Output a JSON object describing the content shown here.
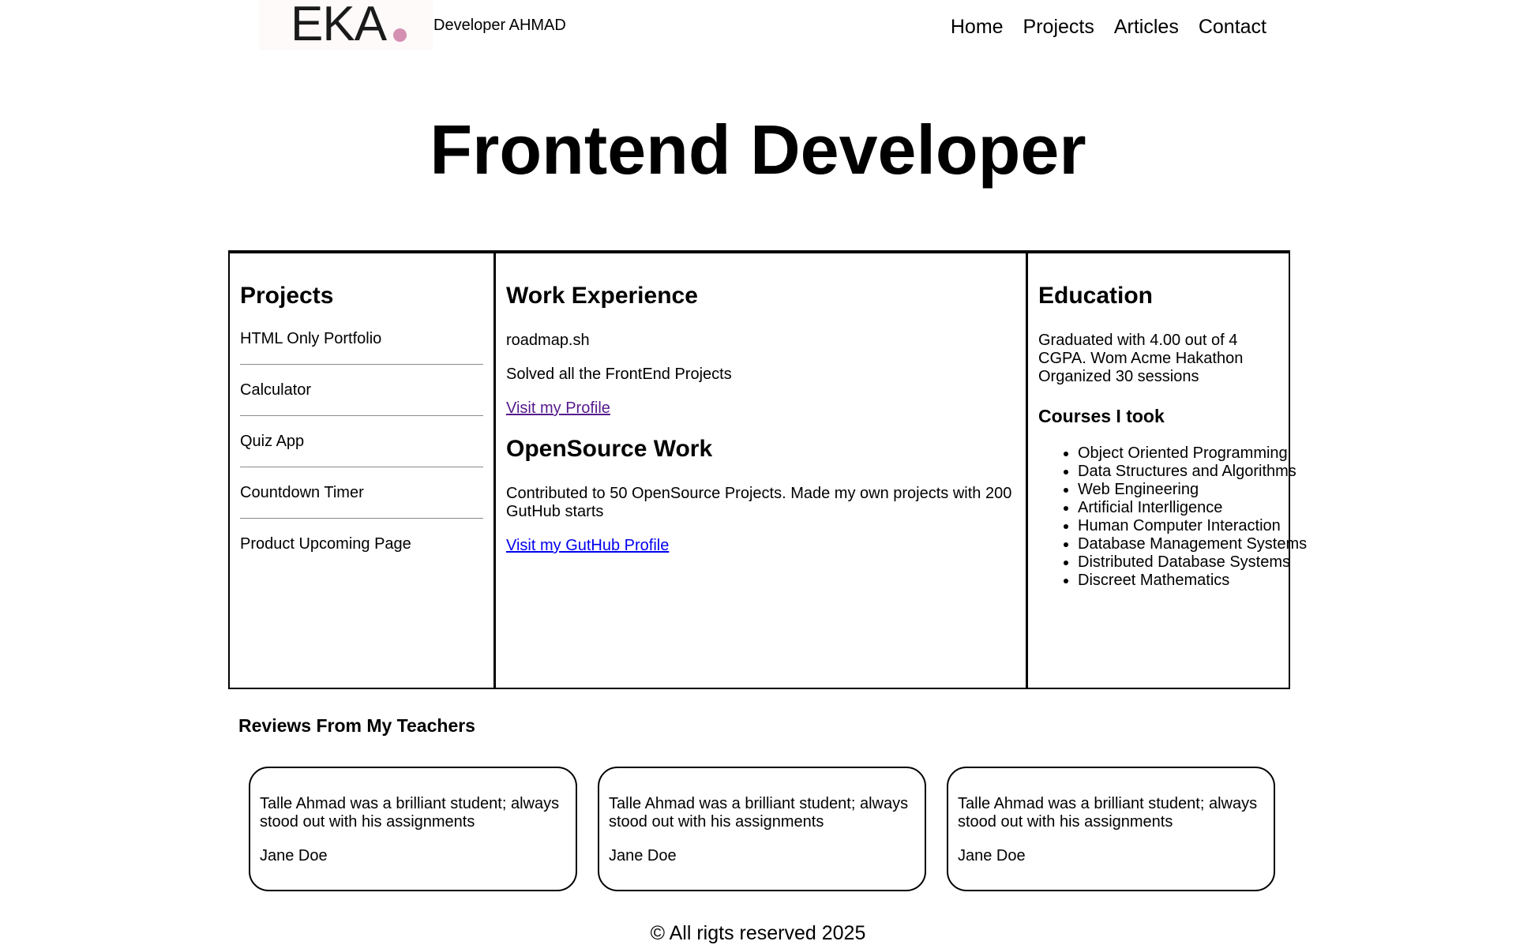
{
  "header": {
    "logo_text": "EKA",
    "logo_dot_color": "#d48fb1",
    "site_name": "Developer AHMAD",
    "nav": [
      "Home",
      "Projects",
      "Articles",
      "Contact"
    ]
  },
  "hero": {
    "title": "Frontend Developer"
  },
  "projects": {
    "heading": "Projects",
    "items": [
      "HTML Only Portfolio",
      "Calculator",
      "Quiz App",
      "Countdown Timer",
      "Product Upcoming Page"
    ]
  },
  "work": {
    "heading": "Work Experience",
    "company": "roadmap.sh",
    "description": "Solved all the FrontEnd Projects",
    "profile_link": "Visit my Profile",
    "opensource_heading": "OpenSource Work",
    "opensource_description": "Contributed to 50 OpenSource Projects. Made my own projects with 200 GutHub starts",
    "github_link": "Visit my GutHub Profile"
  },
  "education": {
    "heading": "Education",
    "summary": "Graduated with 4.00 out of 4 CGPA. Wom Acme Hakathon Organized 30 sessions",
    "courses_heading": "Courses I took",
    "courses": [
      "Object Oriented Programming",
      "Data Structures and Algorithms",
      "Web Engineering",
      "Artificial Interlligence",
      "Human Computer Interaction",
      "Database Management Systems",
      "Distributed Database Systems",
      "Discreet Mathematics"
    ]
  },
  "reviews": {
    "heading": "Reviews From My Teachers",
    "items": [
      {
        "text": "Talle Ahmad was a brilliant student; always stood out with his assignments",
        "author": "Jane Doe"
      },
      {
        "text": "Talle Ahmad was a brilliant student; always stood out with his assignments",
        "author": "Jane Doe"
      },
      {
        "text": "Talle Ahmad was a brilliant student; always stood out with his assignments",
        "author": "Jane Doe"
      }
    ]
  },
  "footer": {
    "text": "© All rigts reserved 2025"
  }
}
